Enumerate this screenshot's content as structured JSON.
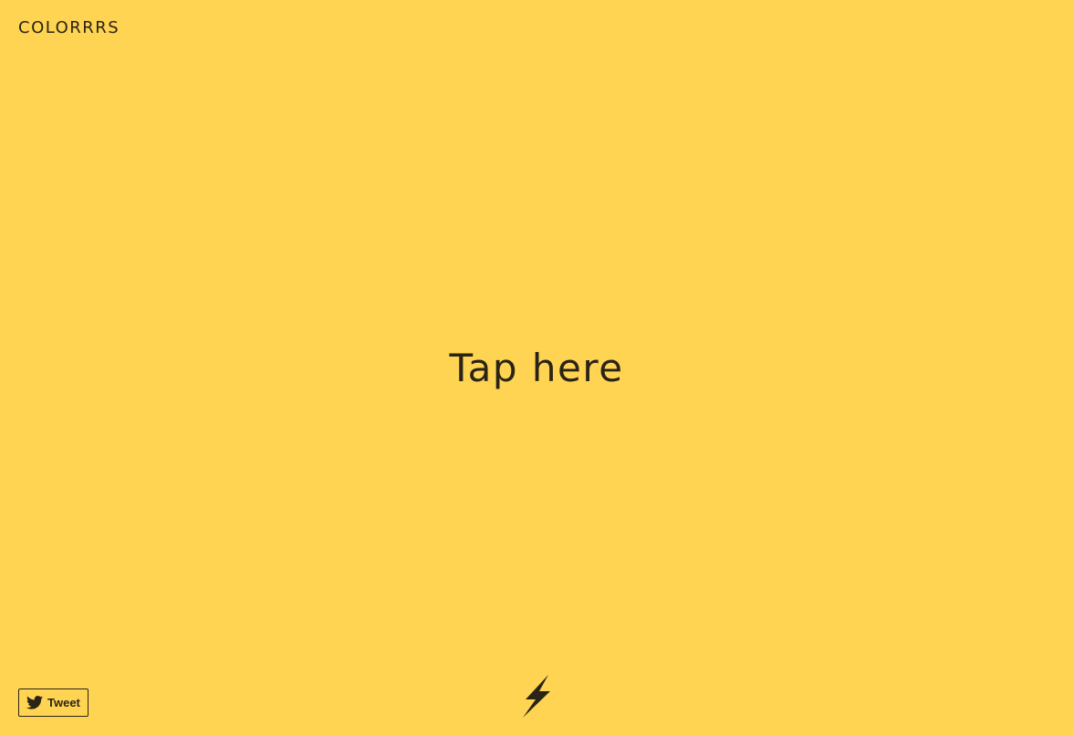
{
  "header": {
    "logo_text": "COLORRRS"
  },
  "main": {
    "tap_text": "Tap here"
  },
  "footer": {
    "tweet_label": "Tweet",
    "tweet_icon": "twitter-bird-icon",
    "bolt_icon": "lightning-bolt-icon"
  },
  "colors": {
    "background": "#FFD452",
    "foreground": "#2a2416"
  }
}
